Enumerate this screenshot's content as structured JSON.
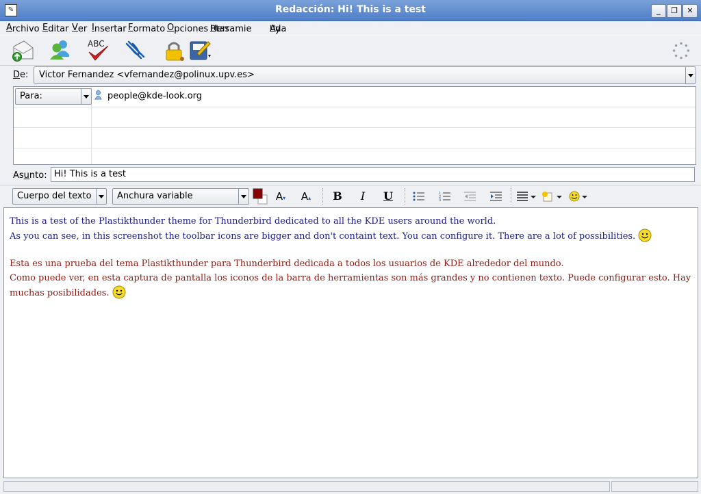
{
  "window": {
    "title": "Redacción: Hi! This is a test",
    "buttons": {
      "minimize": "_",
      "maximize": "❐",
      "close": "✕"
    }
  },
  "menu": [
    {
      "prefix": "",
      "mnemonic": "A",
      "rest": "rchivo"
    },
    {
      "prefix": "",
      "mnemonic": "E",
      "rest": "ditar"
    },
    {
      "prefix": "",
      "mnemonic": "V",
      "rest": "er"
    },
    {
      "prefix": "",
      "mnemonic": "I",
      "rest": "nsertar"
    },
    {
      "prefix": "",
      "mnemonic": "F",
      "rest": "ormato"
    },
    {
      "prefix": "",
      "mnemonic": "O",
      "rest": "pciones"
    },
    {
      "prefix": "Herramie",
      "mnemonic": "n",
      "rest": "tas"
    },
    {
      "prefix": "Ay",
      "mnemonic": "u",
      "rest": "da"
    }
  ],
  "toolbar": {
    "icons": [
      "send-icon",
      "contacts-icon",
      "spellcheck-icon",
      "attach-icon",
      "security-lock-icon",
      "save-icon",
      "throbber-icon"
    ],
    "spellcheck_text": "ABC"
  },
  "from": {
    "label_mnemonic": "D",
    "label_rest": "e:",
    "value": "Victor Fernandez <vfernandez@polinux.upv.es>"
  },
  "addressing": {
    "type": "Para:",
    "recipient": "people@kde-look.org"
  },
  "subject": {
    "label_prefix": "As",
    "label_mnemonic": "u",
    "label_rest": "nto:",
    "value": "Hi! This is a test"
  },
  "format": {
    "paragraph_style": "Cuerpo del texto",
    "font": "Anchura variable",
    "text_color": "#8b0000",
    "bold": "B",
    "italic": "I",
    "underline": "U"
  },
  "body": {
    "english": [
      "This is a test of the Plastikthunder theme for Thunderbird dedicated to all the KDE users around the world.",
      "As you can see, in this screenshot the toolbar icons are bigger and don't containt text. You can configure it. There are a lot of possibilities."
    ],
    "spanish": [
      "Esta es una prueba del tema Plastikthunder para Thunderbird dedicada a todos los usuarios de KDE alrededor del mundo.",
      "Como puede ver, en esta captura de pantalla los iconos de la barra de herramientas son más grandes y no contienen texto. Puede configurar esto. Hay muchas posibilidades."
    ],
    "colors": {
      "english": "#1b1b8a",
      "spanish": "#8b1a12"
    }
  }
}
